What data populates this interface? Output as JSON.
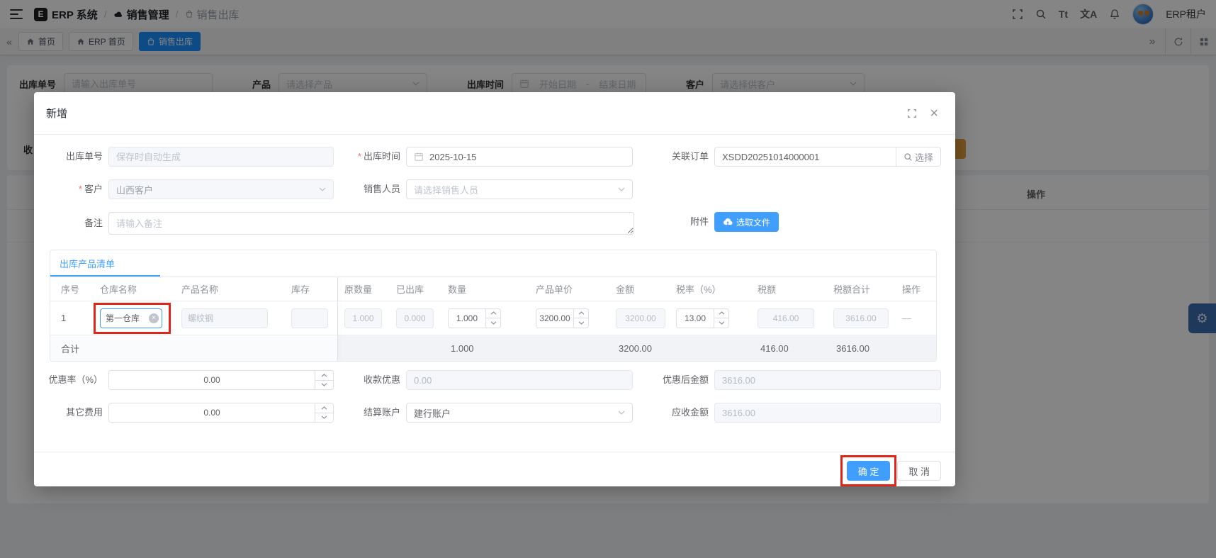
{
  "colors": {
    "primary": "#409eff",
    "tab_active": "#1890ff",
    "annotation": "#e02619",
    "warning": "#e6a23c",
    "gear": "#3d6eb0"
  },
  "navbar": {
    "brand": "ERP 系统",
    "crumb_sep": "/",
    "crumb1": "销售管理",
    "crumb2": "销售出库",
    "font_icon": "Tt",
    "lang_icon": "文A",
    "user": "ERP租户"
  },
  "tabbar": {
    "collapse": "«",
    "expand": "»",
    "tabs": [
      {
        "label": "首页"
      },
      {
        "label": "ERP 首页"
      },
      {
        "label": "销售出库"
      }
    ]
  },
  "filters": {
    "order_no_label": "出库单号",
    "order_no_placeholder": "请输入出库单号",
    "product_label": "产品",
    "product_placeholder": "请选择产品",
    "time_label": "出库时间",
    "time_start": "开始日期",
    "time_sep": "-",
    "time_end": "结束日期",
    "customer_label": "客户",
    "customer_placeholder": "请选择供客户",
    "row2_partial": "收"
  },
  "bg_table": {
    "op_header": "操作"
  },
  "modal": {
    "title": "新增",
    "required_mark": "*",
    "form": {
      "order_no_label": "出库单号",
      "order_no_placeholder": "保存时自动生成",
      "time_label": "出库时间",
      "time_value": "2025-10-15",
      "related_label": "关联订单",
      "related_value": "XSDD20251014000001",
      "related_button": "选择",
      "customer_label": "客户",
      "customer_value": "山西客户",
      "salesman_label": "销售人员",
      "salesman_placeholder": "请选择销售人员",
      "remark_label": "备注",
      "remark_placeholder": "请输入备注",
      "attach_label": "附件",
      "attach_button": "选取文件"
    },
    "list": {
      "tab": "出库产品清单",
      "columns": [
        "序号",
        "仓库名称",
        "产品名称",
        "库存",
        "原数量",
        "已出库",
        "数量",
        "产品单价",
        "金额",
        "税率（%）",
        "税额",
        "税额合计",
        "操作"
      ],
      "row": {
        "no": "1",
        "warehouse": "第一仓库",
        "product": "螺纹钢",
        "stock": "",
        "orig_qty": "1.000",
        "shipped": "0.000",
        "qty": "1.000",
        "price": "3200.00",
        "amount": "3200.00",
        "tax_rate": "13.00",
        "tax": "416.00",
        "tax_total": "3616.00",
        "op": "—"
      },
      "total": {
        "label": "合计",
        "qty": "1.000",
        "amount": "3200.00",
        "tax": "416.00",
        "tax_total": "3616.00"
      }
    },
    "summary": {
      "discount_rate_label": "优惠率（%）",
      "discount_rate_value": "0.00",
      "collect_discount_label": "收款优惠",
      "collect_discount_value": "0.00",
      "after_discount_label": "优惠后金额",
      "after_discount_value": "3616.00",
      "other_fee_label": "其它费用",
      "other_fee_value": "0.00",
      "account_label": "结算账户",
      "account_value": "建行账户",
      "receivable_label": "应收金额",
      "receivable_value": "3616.00"
    },
    "confirm": "确 定",
    "cancel": "取 消"
  }
}
